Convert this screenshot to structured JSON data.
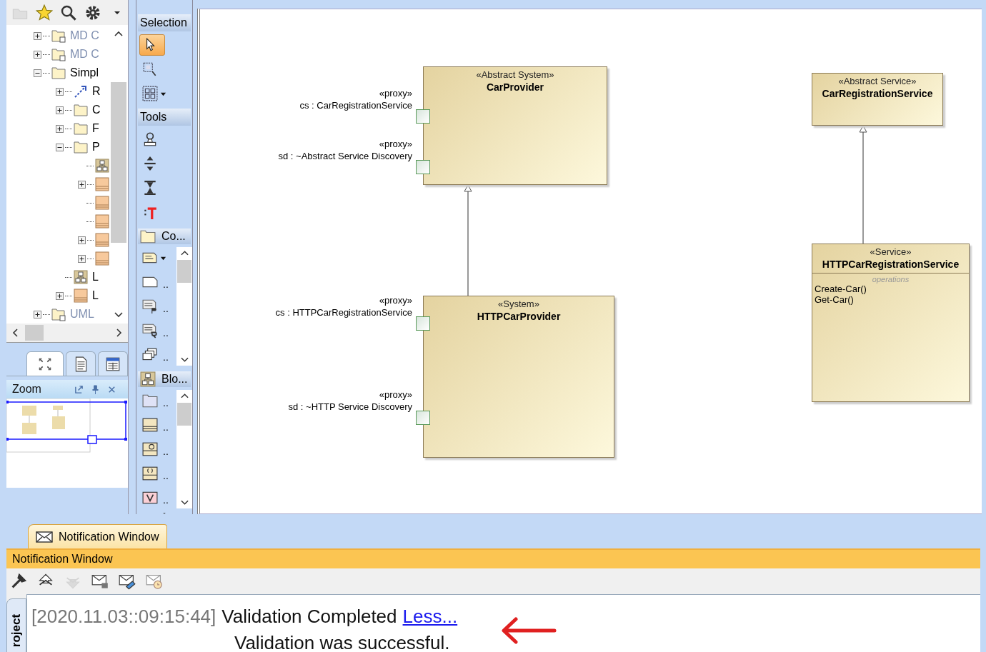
{
  "toolbar": [
    {
      "kind": "open",
      "disabled": true
    },
    {
      "kind": "favorites",
      "disabled": false
    },
    {
      "kind": "search",
      "disabled": false
    },
    {
      "kind": "settings",
      "disabled": false
    },
    {
      "kind": "dropdown",
      "disabled": false
    }
  ],
  "tree": [
    {
      "label": "MD C",
      "kind": "profile",
      "read_only": true,
      "leaf": false,
      "expanded": false
    },
    {
      "label": "MD C",
      "kind": "profile",
      "read_only": true,
      "leaf": false,
      "expanded": false
    },
    {
      "label": "Simpl",
      "kind": "package",
      "read_only": false,
      "leaf": false,
      "expanded": true,
      "children": [
        {
          "label": "R",
          "kind": "relation",
          "read_only": false,
          "leaf": false,
          "expanded": false
        },
        {
          "label": "C",
          "kind": "package",
          "read_only": false,
          "leaf": false,
          "expanded": false
        },
        {
          "label": "F",
          "kind": "package",
          "read_only": false,
          "leaf": false,
          "expanded": false
        },
        {
          "label": "P",
          "kind": "package",
          "read_only": false,
          "leaf": false,
          "expanded": true,
          "children": [
            {
              "kind": "diagram",
              "leaf": true,
              "expanded": false
            },
            {
              "kind": "block",
              "leaf": false,
              "expanded": false
            },
            {
              "kind": "block",
              "leaf": true,
              "expanded": false
            },
            {
              "kind": "block",
              "leaf": true,
              "expanded": false
            },
            {
              "kind": "block",
              "leaf": false,
              "expanded": false
            },
            {
              "kind": "block",
              "leaf": false,
              "expanded": false
            }
          ]
        },
        {
          "label": "L",
          "kind": "diagram",
          "read_only": false,
          "leaf": true,
          "expanded": false
        },
        {
          "label": "L",
          "kind": "block",
          "read_only": false,
          "leaf": false,
          "expanded": false
        }
      ]
    },
    {
      "label": "UML",
      "kind": "profile",
      "read_only": true,
      "leaf": false,
      "expanded": false
    }
  ],
  "zoom_panel": {
    "tabs": [
      {
        "kind": "zoom",
        "selected": true
      },
      {
        "kind": "document",
        "selected": false
      },
      {
        "kind": "table",
        "selected": false
      }
    ],
    "title": "Zoom"
  },
  "palette": [
    {
      "title": "Selection",
      "kind": "header",
      "items": [
        {
          "kind": "pointer",
          "selected": true,
          "dropdown": false
        },
        {
          "kind": "marquee",
          "selected": false,
          "dropdown": false
        },
        {
          "kind": "group-select",
          "selected": false,
          "dropdown": true
        }
      ]
    },
    {
      "title": "Tools",
      "kind": "header",
      "items": [
        {
          "kind": "stamp",
          "selected": false,
          "dropdown": false
        },
        {
          "kind": "split",
          "selected": false,
          "dropdown": false
        },
        {
          "kind": "merge",
          "selected": false,
          "dropdown": false
        },
        {
          "kind": "text",
          "selected": false,
          "dropdown": false
        }
      ]
    },
    {
      "title": "Co...",
      "kind": "group",
      "items": [
        {
          "kind": "note",
          "selected": false,
          "dropdown": true
        },
        {
          "kind": "comment",
          "label": "..",
          "selected": false,
          "dropdown": false
        },
        {
          "kind": "doc-p",
          "label": "..",
          "selected": false,
          "dropdown": false
        },
        {
          "kind": "doc-r",
          "label": "..",
          "selected": false,
          "dropdown": false
        },
        {
          "kind": "stack",
          "label": "..",
          "selected": false,
          "dropdown": false
        }
      ]
    },
    {
      "title": "Blo...",
      "kind": "group",
      "items": [
        {
          "kind": "package-blue",
          "label": "..",
          "selected": false,
          "dropdown": false
        },
        {
          "kind": "block-plain",
          "label": "..",
          "selected": false,
          "dropdown": false
        },
        {
          "kind": "interface",
          "label": "..",
          "selected": false,
          "dropdown": false
        },
        {
          "kind": "constraint",
          "label": "..",
          "selected": false,
          "dropdown": false
        },
        {
          "kind": "value",
          "label": "..",
          "selected": false,
          "dropdown": false
        }
      ]
    }
  ],
  "diagram": {
    "blocks": [
      {
        "stereotype": "«Abstract System»",
        "name": "CarProvider",
        "ports": [
          {
            "stereotype": "«proxy»",
            "label": "cs : CarRegistrationService"
          },
          {
            "stereotype": "«proxy»",
            "label": "sd : ~Abstract Service Discovery"
          }
        ]
      },
      {
        "stereotype": "«System»",
        "name": "HTTPCarProvider",
        "generalizes_previous": true,
        "ports": [
          {
            "stereotype": "«proxy»",
            "label": "cs : HTTPCarRegistrationService"
          },
          {
            "stereotype": "«proxy»",
            "label": "sd : ~HTTP Service Discovery"
          }
        ]
      },
      {
        "stereotype": "«Abstract Service»",
        "name": "CarRegistrationService"
      },
      {
        "stereotype": "«Service»",
        "name": "HTTPCarRegistrationService",
        "generalizes_previous": true,
        "compartment": {
          "title": "operations",
          "items": [
            "Create-Car()",
            "Get-Car()"
          ]
        }
      }
    ]
  },
  "notifications": {
    "tab": "Notification Window",
    "title": "Notification Window",
    "tools": [
      {
        "kind": "options",
        "disabled": false
      },
      {
        "kind": "collapse",
        "disabled": false
      },
      {
        "kind": "expand",
        "disabled": true
      },
      {
        "kind": "lock",
        "disabled": false
      },
      {
        "kind": "clear",
        "disabled": false
      },
      {
        "kind": "schedule",
        "disabled": false
      }
    ],
    "side_tab": "roject",
    "messages": [
      {
        "timestamp": "[2020.11.03::09:15:44]",
        "text": "Validation Completed",
        "link": "Less...",
        "detail": "Validation was successful."
      }
    ]
  }
}
